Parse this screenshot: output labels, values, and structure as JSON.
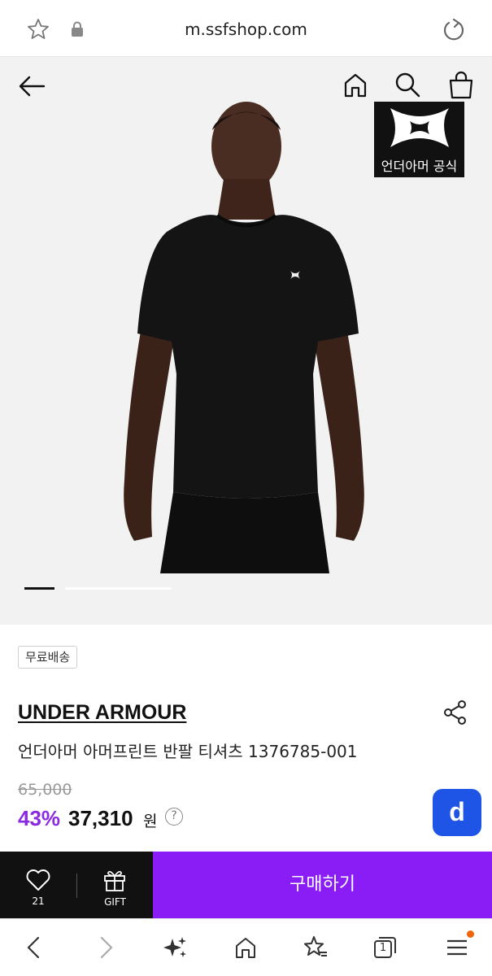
{
  "browser": {
    "url": "m.ssfshop.com"
  },
  "product": {
    "brand_badge_text": "언더아머 공식",
    "shipping_tag": "무료배송",
    "brand": "UNDER ARMOUR",
    "name": "언더아머 아머프린트 반팔 티셔츠 1376785-001",
    "original_price": "65,000",
    "discount": "43%",
    "price": "37,310",
    "currency": "원",
    "help_symbol": "?",
    "image_carousel": {
      "current": 1,
      "total": 2
    }
  },
  "floating_button": {
    "label": "d"
  },
  "buy_bar": {
    "wish_count": "21",
    "gift_label": "GIFT",
    "buy_label": "구매하기"
  },
  "toolbar": {
    "tabs_count": "1"
  },
  "colors": {
    "accent_purple": "#8a1cf5",
    "discount_purple": "#8a2be2",
    "floating_blue": "#1e55e6",
    "notification_orange": "#f0650a"
  },
  "icons": [
    "star-icon",
    "lock-icon",
    "reload-icon",
    "back-arrow-icon",
    "home-icon",
    "search-icon",
    "shopping-bag-icon",
    "share-icon",
    "heart-icon",
    "gift-icon",
    "sparkle-icon",
    "favorites-icon",
    "tabs-icon",
    "menu-icon",
    "chevron-left-icon",
    "chevron-right-icon"
  ]
}
